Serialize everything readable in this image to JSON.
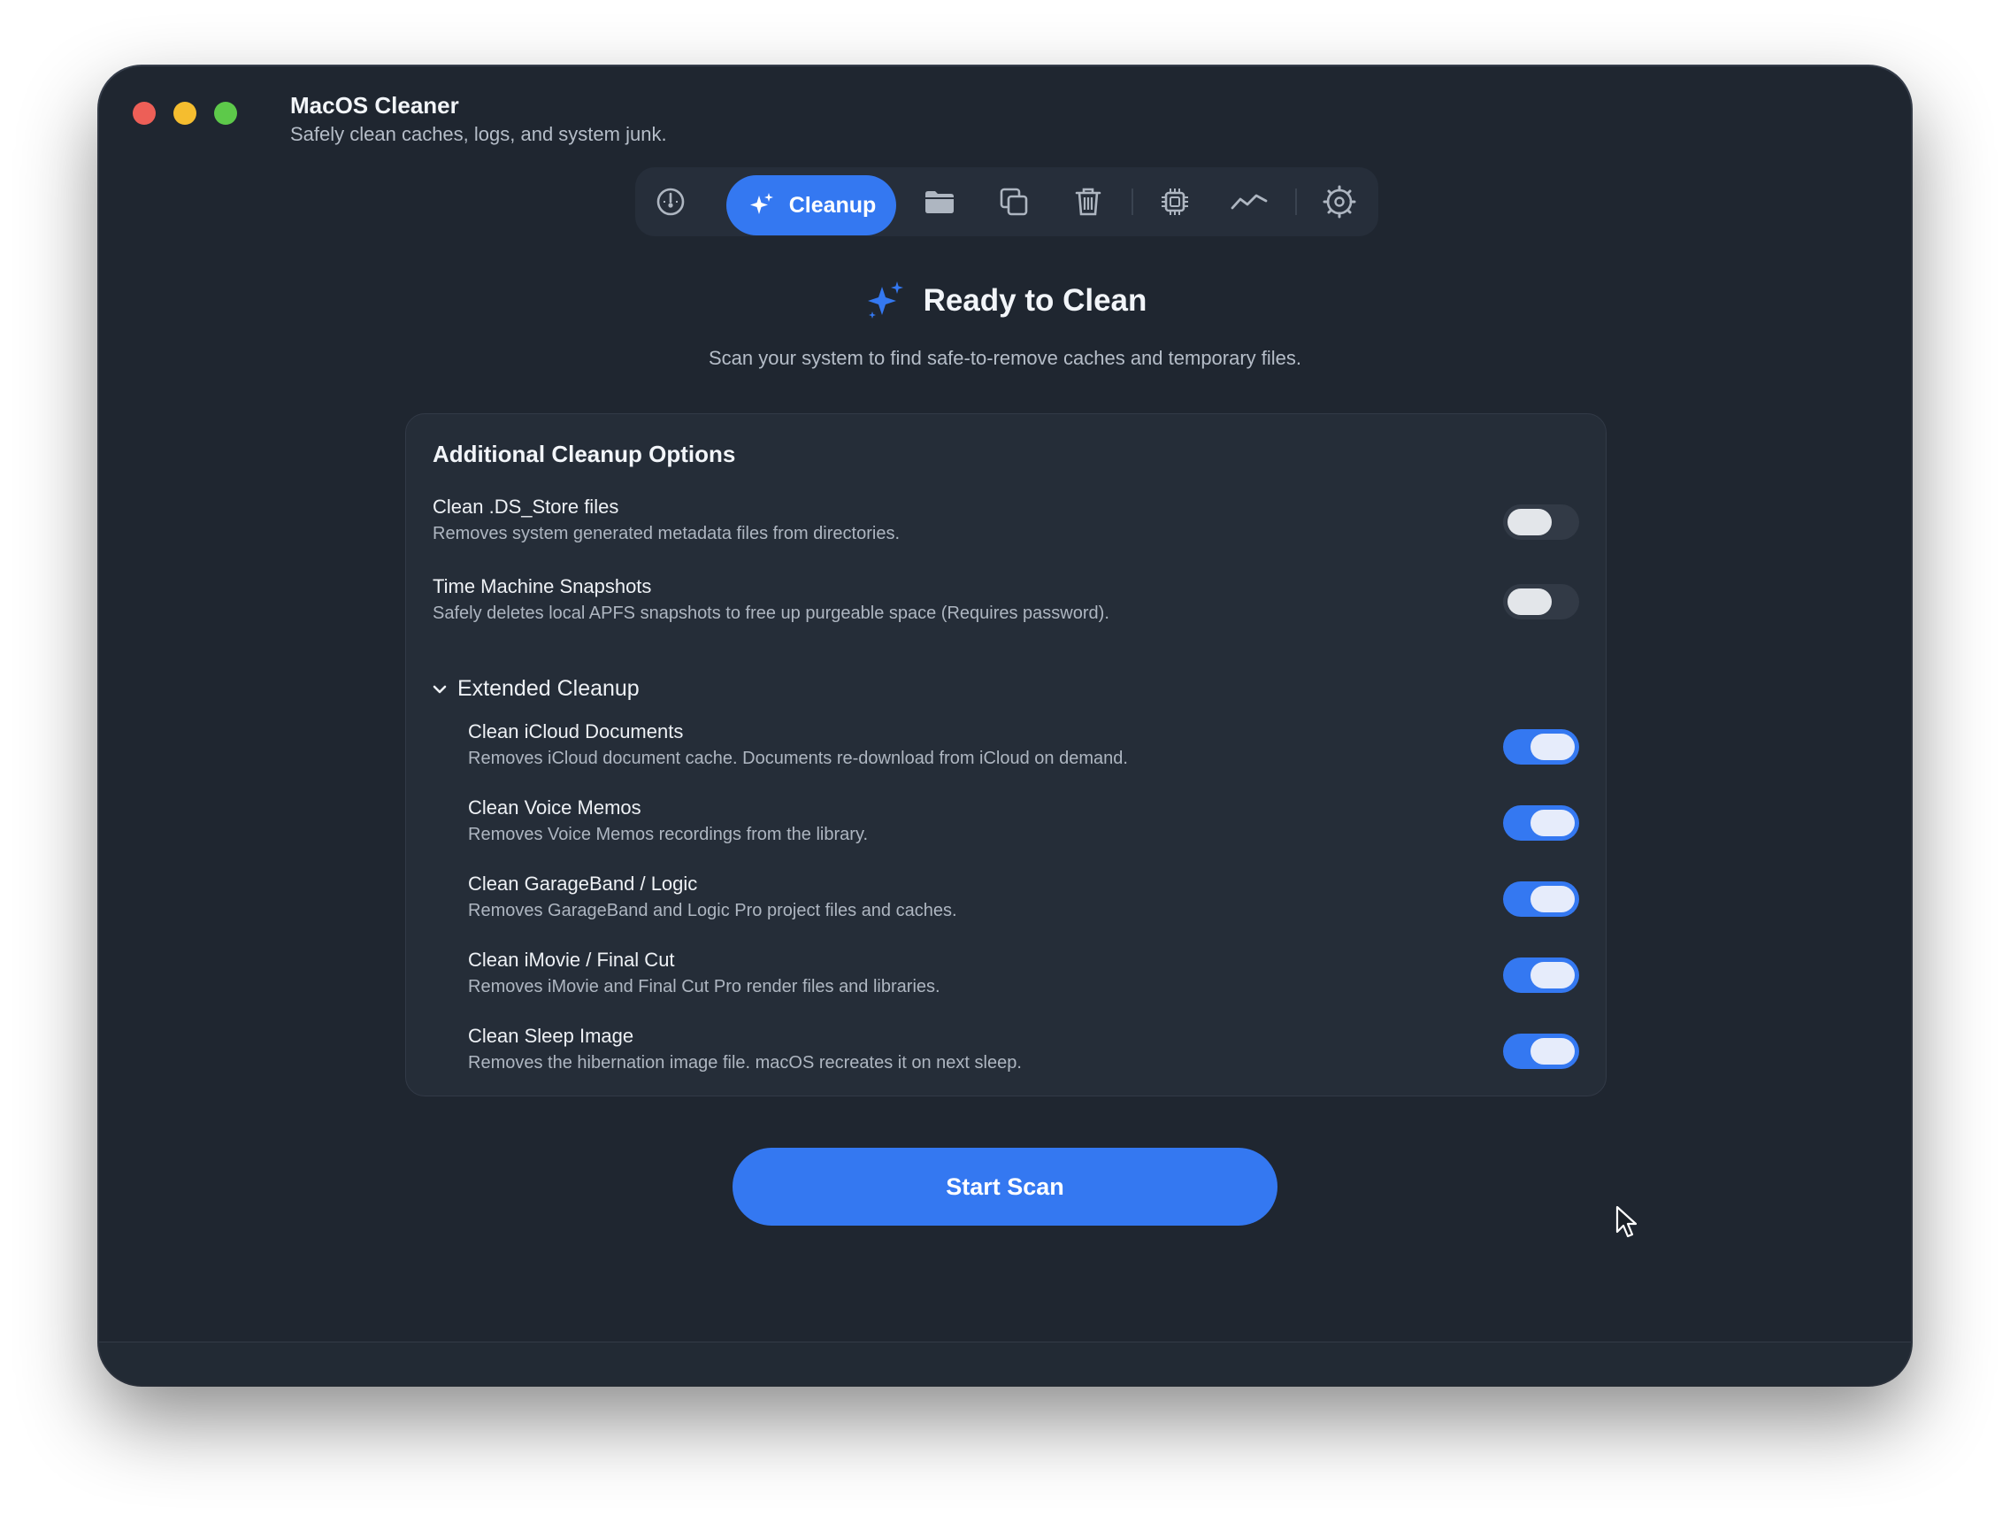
{
  "window": {
    "title": "MacOS Cleaner",
    "subtitle": "Safely clean caches, logs, and system junk."
  },
  "toolbar": {
    "active_tab_label": "Cleanup",
    "tabs": [
      {
        "icon": "dashboard-gauge-icon"
      },
      {
        "icon": "sparkles-icon",
        "label": "Cleanup",
        "active": true
      },
      {
        "icon": "folder-icon"
      },
      {
        "icon": "duplicates-icon"
      },
      {
        "icon": "trash-icon"
      },
      {
        "icon": "cpu-chip-icon"
      },
      {
        "icon": "activity-graph-icon"
      },
      {
        "icon": "settings-gear-icon"
      }
    ]
  },
  "hero": {
    "title": "Ready to Clean",
    "subtitle": "Scan your system to find safe-to-remove caches and temporary files."
  },
  "options": {
    "title": "Additional Cleanup Options",
    "items": [
      {
        "label": "Clean .DS_Store files",
        "description": "Removes system generated metadata files from directories.",
        "enabled": false
      },
      {
        "label": "Time Machine Snapshots",
        "description": "Safely deletes local APFS snapshots to free up purgeable space (Requires password).",
        "enabled": false
      }
    ],
    "extended": {
      "title": "Extended Cleanup",
      "expanded": true,
      "items": [
        {
          "label": "Clean iCloud Documents",
          "description": "Removes iCloud document cache. Documents re-download from iCloud on demand.",
          "enabled": true
        },
        {
          "label": "Clean Voice Memos",
          "description": "Removes Voice Memos recordings from the library.",
          "enabled": true
        },
        {
          "label": "Clean GarageBand / Logic",
          "description": "Removes GarageBand and Logic Pro project files and caches.",
          "enabled": true
        },
        {
          "label": "Clean iMovie / Final Cut",
          "description": "Removes iMovie and Final Cut Pro render files and libraries.",
          "enabled": true
        },
        {
          "label": "Clean Sleep Image",
          "description": "Removes the hibernation image file. macOS recreates it on next sleep.",
          "enabled": true
        }
      ]
    }
  },
  "actions": {
    "start_scan_label": "Start Scan"
  },
  "colors": {
    "accent": "#3478f1",
    "window_bg": "#1f2630",
    "panel_bg": "#252d38"
  }
}
